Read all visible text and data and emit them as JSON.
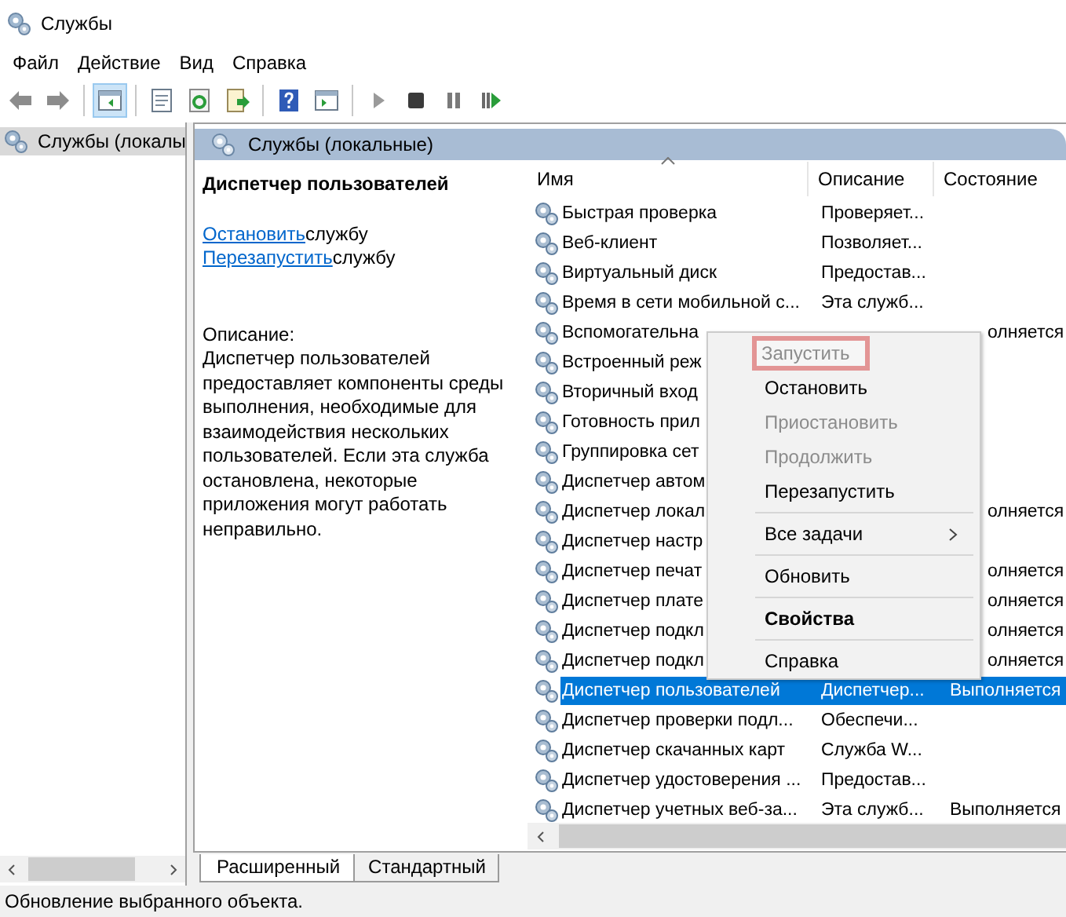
{
  "window": {
    "title": "Службы"
  },
  "menu": [
    "Файл",
    "Действие",
    "Вид",
    "Справка"
  ],
  "toolbar": [
    {
      "kind": "back",
      "pressed": false
    },
    {
      "kind": "forward",
      "pressed": false
    },
    {
      "kind": "separator"
    },
    {
      "kind": "tree",
      "pressed": true
    },
    {
      "kind": "separator"
    },
    {
      "kind": "properties",
      "pressed": false
    },
    {
      "kind": "refresh",
      "pressed": false
    },
    {
      "kind": "export",
      "pressed": false
    },
    {
      "kind": "separator"
    },
    {
      "kind": "help",
      "pressed": false
    },
    {
      "kind": "view",
      "pressed": false
    },
    {
      "kind": "separator"
    },
    {
      "kind": "play",
      "pressed": false
    },
    {
      "kind": "stop",
      "pressed": false
    },
    {
      "kind": "pause",
      "pressed": false
    },
    {
      "kind": "resume",
      "pressed": false
    }
  ],
  "tree": [
    {
      "label": "Службы (локалы",
      "selected": true
    }
  ],
  "header": "Службы (локальные)",
  "details": {
    "title": "Диспетчер пользователей",
    "actions": [
      {
        "link": "Остановить",
        "text": "службу"
      },
      {
        "link": "Перезапустить",
        "text": "службу"
      }
    ],
    "description_label": "Описание:",
    "description": "Диспетчер пользователей предоставляет компоненты среды выполнения, необходимые для взаимодействия нескольких пользователей. Если эта служба остановлена, некоторые приложения могут работать неправильно."
  },
  "columns": [
    {
      "label": "Имя",
      "sorted": true
    },
    {
      "label": "Описание",
      "sorted": false
    },
    {
      "label": "Состояние",
      "sorted": false
    }
  ],
  "rows": [
    {
      "name": "Быстрая проверка",
      "description": "Проверяет...",
      "selected": false
    },
    {
      "name": "Веб-клиент",
      "description": "Позволяет...",
      "selected": false
    },
    {
      "name": "Виртуальный диск",
      "description": "Предостав...",
      "selected": false
    },
    {
      "name": "Время в сети мобильной с...",
      "description": "Эта служб...",
      "selected": false
    },
    {
      "name": "Вспомогательна",
      "status": "олняется",
      "selected": false
    },
    {
      "name": "Встроенный реж",
      "selected": false
    },
    {
      "name": "Вторичный вход",
      "selected": false
    },
    {
      "name": "Готовность прил",
      "selected": false
    },
    {
      "name": "Группировка сет",
      "selected": false
    },
    {
      "name": "Диспетчер автом",
      "selected": false
    },
    {
      "name": "Диспетчер локал",
      "status": "олняется",
      "selected": false
    },
    {
      "name": "Диспетчер настр",
      "selected": false
    },
    {
      "name": "Диспетчер печат",
      "status": "олняется",
      "selected": false
    },
    {
      "name": "Диспетчер плате",
      "status": "олняется",
      "selected": false
    },
    {
      "name": "Диспетчер подкл",
      "status": "олняется",
      "selected": false
    },
    {
      "name": "Диспетчер подкл",
      "status": "олняется",
      "selected": false
    },
    {
      "name": "Диспетчер пользователей",
      "description": "Диспетчер...",
      "status": "Выполняется",
      "selected": true
    },
    {
      "name": "Диспетчер проверки подл...",
      "description": "Обеспечи...",
      "selected": false
    },
    {
      "name": "Диспетчер скачанных карт",
      "description": "Служба W...",
      "selected": false
    },
    {
      "name": "Диспетчер удостоверения ...",
      "description": "Предостав...",
      "selected": false
    },
    {
      "name": "Диспетчер учетных веб-за...",
      "description": "Эта служб...",
      "status": "Выполняется",
      "selected": false
    }
  ],
  "context_menu": [
    {
      "kind": "item",
      "label": "Запустить",
      "disabled": true,
      "bold": false,
      "highlighted": true
    },
    {
      "kind": "item",
      "label": "Остановить",
      "disabled": false,
      "bold": false,
      "highlighted": false
    },
    {
      "kind": "item",
      "label": "Приостановить",
      "disabled": true,
      "bold": false,
      "highlighted": false
    },
    {
      "kind": "item",
      "label": "Продолжить",
      "disabled": true,
      "bold": false,
      "highlighted": false
    },
    {
      "kind": "item",
      "label": "Перезапустить",
      "disabled": false,
      "bold": false,
      "highlighted": false
    },
    {
      "kind": "separator"
    },
    {
      "kind": "submenu",
      "label": "Все задачи",
      "disabled": false,
      "bold": false,
      "highlighted": false
    },
    {
      "kind": "separator"
    },
    {
      "kind": "item",
      "label": "Обновить",
      "disabled": false,
      "bold": false,
      "highlighted": false
    },
    {
      "kind": "separator"
    },
    {
      "kind": "item",
      "label": "Свойства",
      "disabled": false,
      "bold": true,
      "highlighted": false
    },
    {
      "kind": "separator"
    },
    {
      "kind": "item",
      "label": "Справка",
      "disabled": false,
      "bold": false,
      "highlighted": false
    }
  ],
  "tabs": [
    {
      "label": "Расширенный",
      "selected": true
    },
    {
      "label": "Стандартный",
      "selected": false
    }
  ],
  "status_bar": "Обновление выбранного объекта."
}
